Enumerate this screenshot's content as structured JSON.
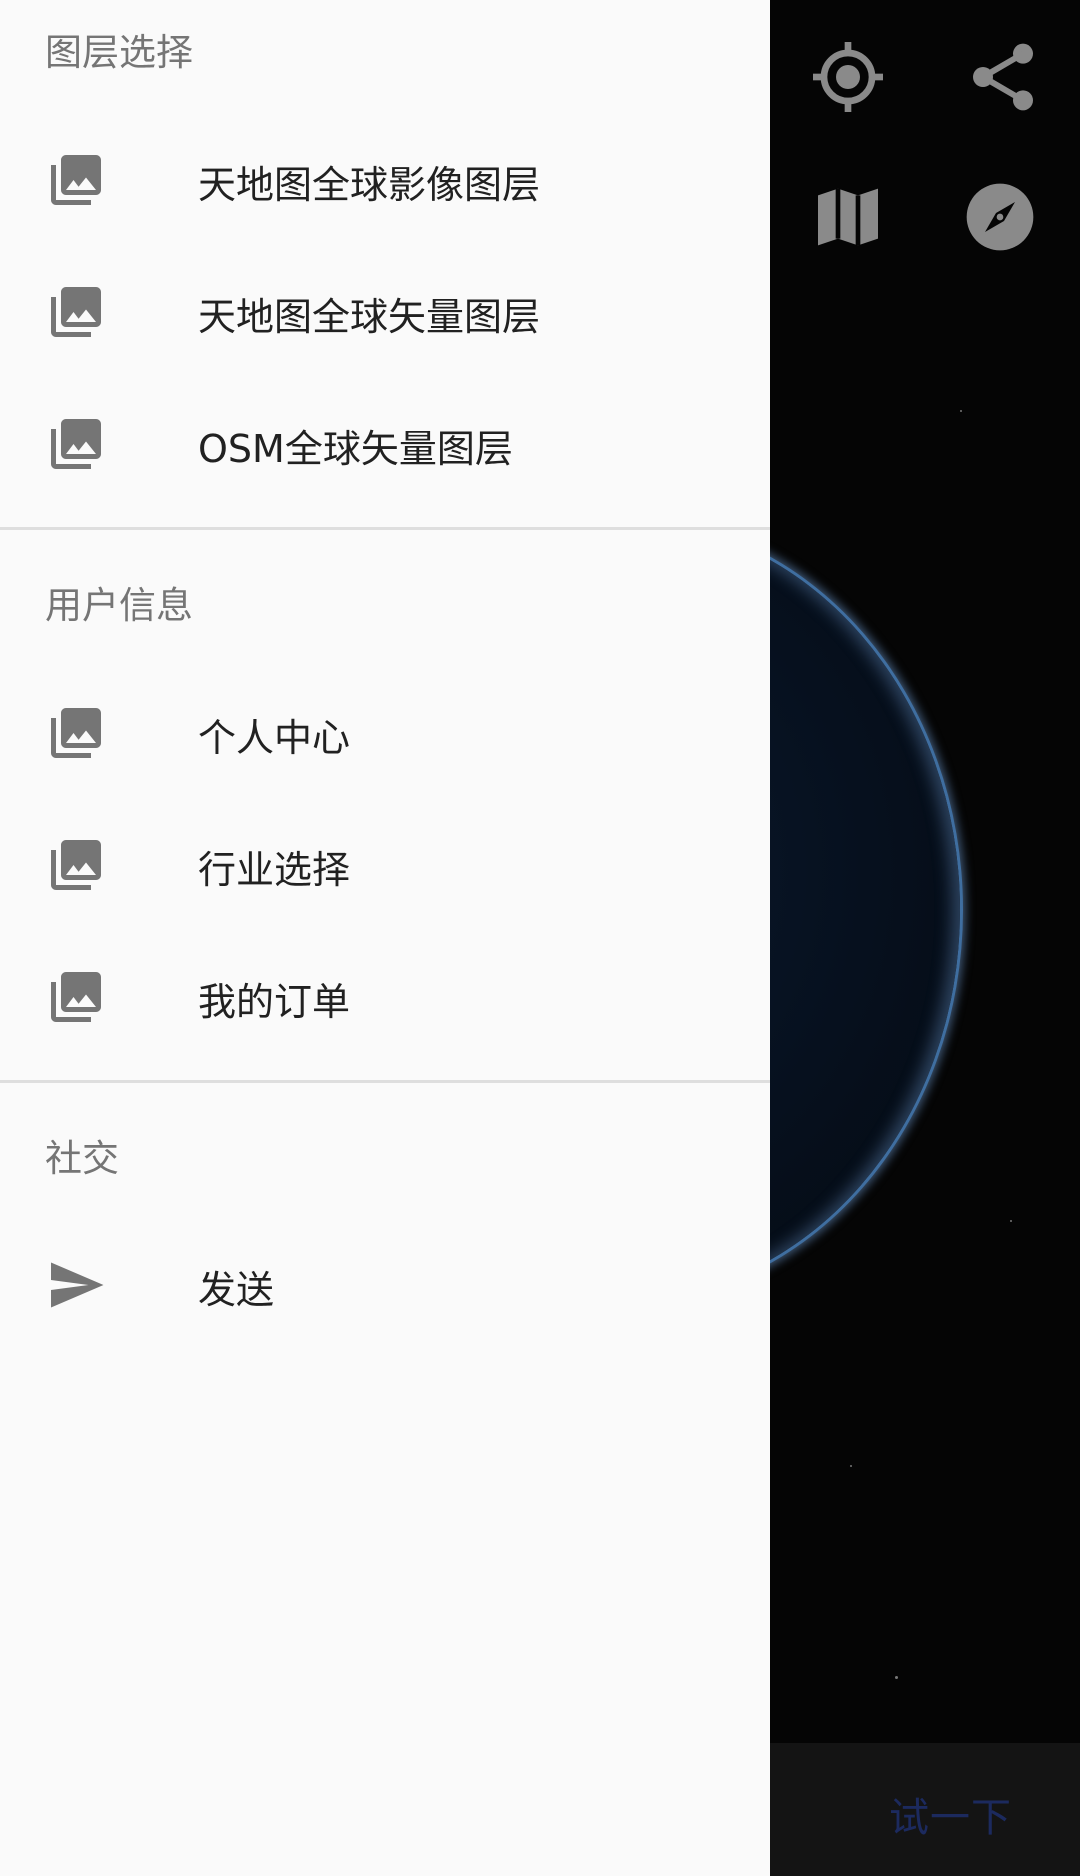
{
  "drawer": {
    "sections": [
      {
        "title": "图层选择",
        "items": [
          {
            "label": "天地图全球影像图层",
            "icon": "photo-library-icon"
          },
          {
            "label": "天地图全球矢量图层",
            "icon": "photo-library-icon"
          },
          {
            "label": "OSM全球矢量图层",
            "icon": "photo-library-icon"
          }
        ]
      },
      {
        "title": "用户信息",
        "items": [
          {
            "label": "个人中心",
            "icon": "photo-library-icon"
          },
          {
            "label": "行业选择",
            "icon": "photo-library-icon"
          },
          {
            "label": "我的订单",
            "icon": "photo-library-icon"
          }
        ]
      },
      {
        "title": "社交",
        "items": [
          {
            "label": "发送",
            "icon": "send-icon"
          }
        ]
      }
    ]
  },
  "map": {
    "icons": [
      "my-location-icon",
      "share-icon",
      "map-icon",
      "compass-icon"
    ],
    "try_button_label": "试一下"
  },
  "colors": {
    "drawer_bg": "#fafafa",
    "section_header": "#757575",
    "item_text": "#212121",
    "icon_gray": "#757575",
    "map_icon_gray": "#8a8a8a",
    "try_button_text": "#1c2a5e"
  }
}
